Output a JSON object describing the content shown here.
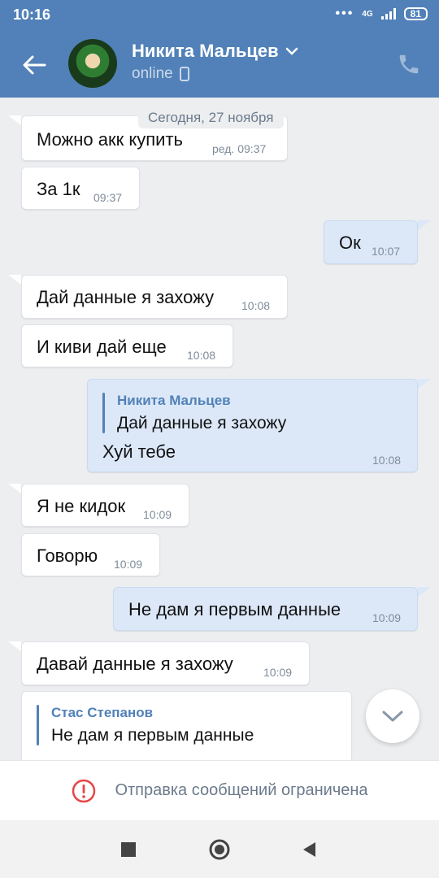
{
  "status": {
    "time": "10:16",
    "network": "4G",
    "battery": "81"
  },
  "header": {
    "name": "Никита Мальцев",
    "presence": "online"
  },
  "date_divider": "Сегодня, 27 ноября",
  "messages": [
    {
      "dir": "in",
      "text": "Можно акк купить",
      "time": "ред. 09:37"
    },
    {
      "dir": "in",
      "text": "За 1к",
      "time": "09:37"
    },
    {
      "dir": "out",
      "text": "Ок",
      "time": "10:07"
    },
    {
      "dir": "in",
      "text": "Дай данные я захожу",
      "time": "10:08"
    },
    {
      "dir": "in",
      "text": "И киви дай еще",
      "time": "10:08"
    },
    {
      "dir": "out",
      "quote_name": "Никита Мальцев",
      "quote_text": "Дай данные я захожу",
      "text": "Хуй тебе",
      "time": "10:08"
    },
    {
      "dir": "in",
      "text": "Я не кидок",
      "time": "10:09"
    },
    {
      "dir": "in",
      "text": "Говорю",
      "time": "10:09"
    },
    {
      "dir": "out",
      "text": "Не дам я первым данные",
      "time": "10:09"
    },
    {
      "dir": "in",
      "text": "Давай данные я захожу",
      "time": "10:09"
    },
    {
      "dir": "in",
      "quote_name": "Стас Степанов",
      "quote_text": "Не дам я первым данные"
    }
  ],
  "footer": {
    "restricted_text": "Отправка сообщений ограничена"
  },
  "icons": {
    "back": "arrow-left-icon",
    "call": "phone-icon",
    "scroll": "chevron-down-icon",
    "warning": "alert-circle-icon"
  },
  "colors": {
    "header": "#5181b8",
    "out_bubble": "#dce8f8",
    "in_bubble": "#ffffff",
    "accent": "#5181b8",
    "warning": "#e64646"
  }
}
